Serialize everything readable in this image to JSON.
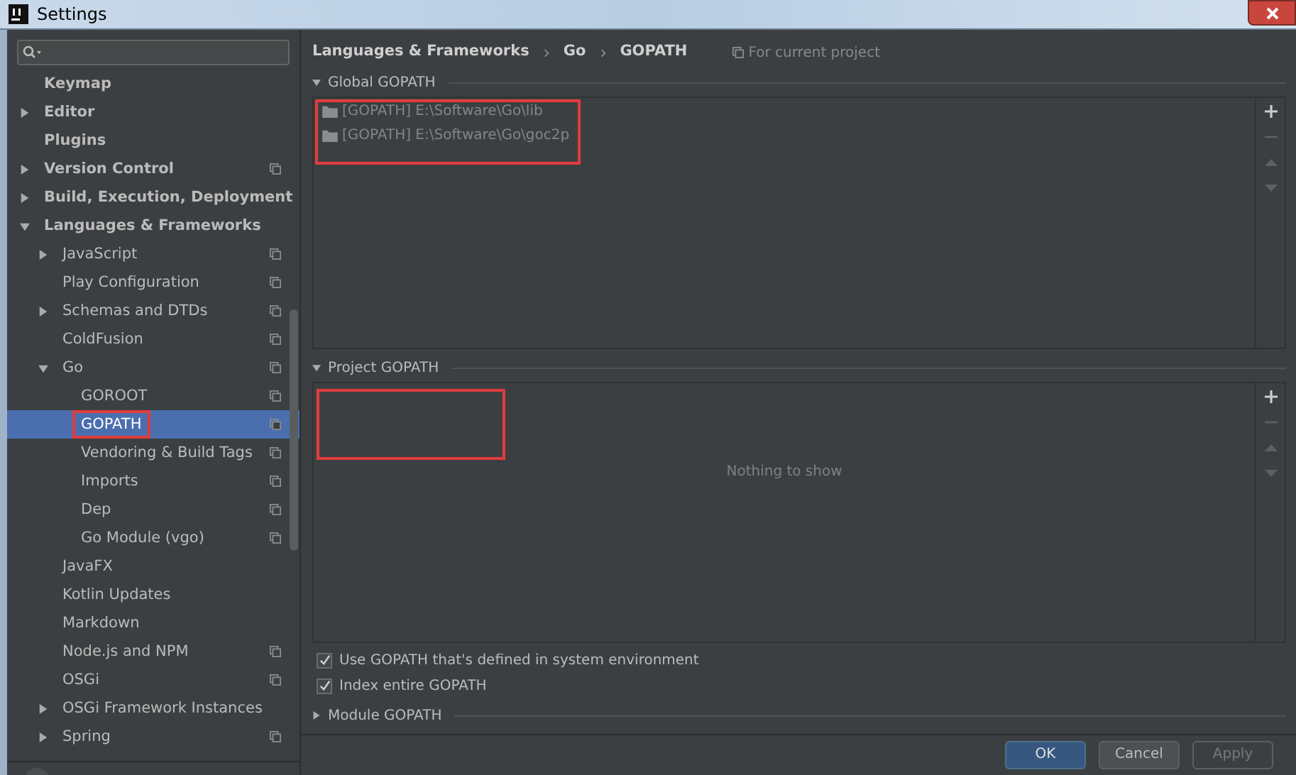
{
  "window": {
    "title": "Settings"
  },
  "sidebar": {
    "tree": [
      {
        "label": "Keymap",
        "selected": false,
        "project_level": false,
        "highlighted": false
      },
      {
        "label": "Editor",
        "expanded": false,
        "selected": false,
        "project_level": false,
        "highlighted": false
      },
      {
        "label": "Plugins",
        "selected": false,
        "project_level": false,
        "highlighted": false
      },
      {
        "label": "Version Control",
        "expanded": false,
        "selected": false,
        "project_level": true,
        "highlighted": false
      },
      {
        "label": "Build, Execution, Deployment",
        "expanded": false,
        "selected": false,
        "project_level": false,
        "highlighted": false
      },
      {
        "label": "Languages & Frameworks",
        "expanded": true,
        "selected": false,
        "project_level": false,
        "highlighted": false,
        "children": [
          {
            "label": "JavaScript",
            "expanded": false,
            "selected": false,
            "project_level": true,
            "highlighted": false
          },
          {
            "label": "Play Configuration",
            "selected": false,
            "project_level": true,
            "highlighted": false
          },
          {
            "label": "Schemas and DTDs",
            "expanded": false,
            "selected": false,
            "project_level": true,
            "highlighted": false
          },
          {
            "label": "ColdFusion",
            "selected": false,
            "project_level": true,
            "highlighted": false
          },
          {
            "label": "Go",
            "expanded": true,
            "selected": false,
            "project_level": true,
            "highlighted": false,
            "children": [
              {
                "label": "GOROOT",
                "selected": false,
                "project_level": true,
                "highlighted": false
              },
              {
                "label": "GOPATH",
                "selected": true,
                "project_level": true,
                "highlighted": true
              },
              {
                "label": "Vendoring & Build Tags",
                "selected": false,
                "project_level": true,
                "highlighted": false
              },
              {
                "label": "Imports",
                "selected": false,
                "project_level": true,
                "highlighted": false
              },
              {
                "label": "Dep",
                "selected": false,
                "project_level": true,
                "highlighted": false
              },
              {
                "label": "Go Module (vgo)",
                "selected": false,
                "project_level": true,
                "highlighted": false
              }
            ]
          },
          {
            "label": "JavaFX",
            "selected": false,
            "project_level": false,
            "highlighted": false
          },
          {
            "label": "Kotlin Updates",
            "selected": false,
            "project_level": false,
            "highlighted": false
          },
          {
            "label": "Markdown",
            "selected": false,
            "project_level": false,
            "highlighted": false
          },
          {
            "label": "Node.js and NPM",
            "selected": false,
            "project_level": true,
            "highlighted": false
          },
          {
            "label": "OSGi",
            "selected": false,
            "project_level": true,
            "highlighted": false
          },
          {
            "label": "OSGi Framework Instances",
            "expanded": false,
            "selected": false,
            "project_level": false,
            "highlighted": false
          },
          {
            "label": "Spring",
            "expanded": false,
            "selected": false,
            "project_level": true,
            "highlighted": false
          }
        ]
      }
    ]
  },
  "breadcrumb": [
    "Languages & Frameworks",
    "Go",
    "GOPATH"
  ],
  "scope_note": "For current project",
  "global_gopath": {
    "title": "Global GOPATH",
    "expanded": true,
    "highlighted": true,
    "items": [
      "[GOPATH] E:\\Software\\Go\\lib",
      "[GOPATH] E:\\Software\\Go\\goc2p"
    ]
  },
  "project_gopath": {
    "title": "Project GOPATH",
    "expanded": true,
    "highlighted": true,
    "empty_text": "Nothing to show"
  },
  "options": [
    {
      "label": "Use GOPATH that's defined in system environment",
      "checked": true
    },
    {
      "label": "Index entire GOPATH",
      "checked": true
    }
  ],
  "module_gopath": {
    "title": "Module GOPATH",
    "expanded": false
  },
  "buttons": [
    {
      "label": "OK",
      "kind": "primary"
    },
    {
      "label": "Cancel",
      "kind": "normal"
    },
    {
      "label": "Apply",
      "kind": "disabled"
    }
  ]
}
